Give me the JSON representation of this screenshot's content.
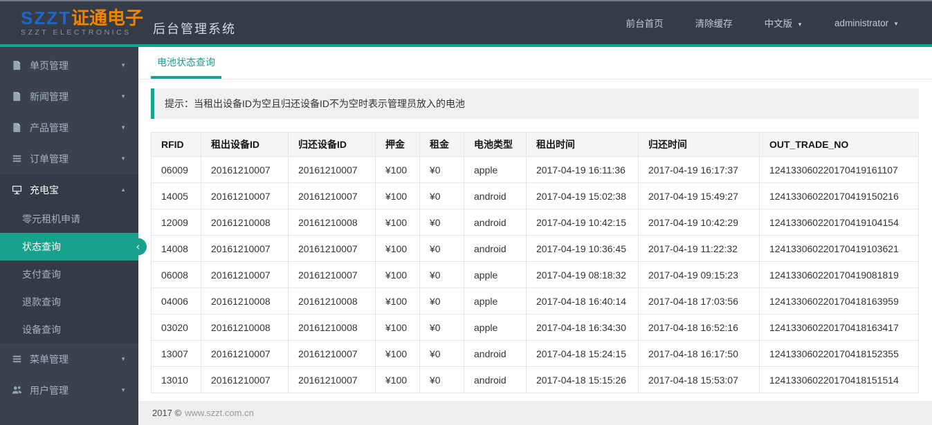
{
  "header": {
    "logo": {
      "brand": "SZZT",
      "brand_cn": "证通电子",
      "sub": "SZZT ELECTRONICS"
    },
    "app_title": "后台管理系统",
    "nav": [
      {
        "name": "home",
        "label": "前台首页",
        "caret": false
      },
      {
        "name": "clear-cache",
        "label": "清除缓存",
        "caret": false
      },
      {
        "name": "language",
        "label": "中文版",
        "caret": true
      },
      {
        "name": "user",
        "label": "administrator",
        "caret": true
      }
    ]
  },
  "sidebar": {
    "items": [
      {
        "name": "single-page",
        "label": "单页管理",
        "icon": "file-icon",
        "chevron": "down"
      },
      {
        "name": "news",
        "label": "新闻管理",
        "icon": "file-icon",
        "chevron": "down"
      },
      {
        "name": "product",
        "label": "产品管理",
        "icon": "file-icon",
        "chevron": "down"
      },
      {
        "name": "order",
        "label": "订单管理",
        "icon": "list-icon",
        "chevron": "down"
      },
      {
        "name": "powerbank",
        "label": "充电宝",
        "icon": "desktop-icon",
        "chevron": "up",
        "expanded": true,
        "children": [
          {
            "name": "zero-rent-apply",
            "label": "零元租机申请"
          },
          {
            "name": "status-query",
            "label": "状态查询",
            "active": true
          },
          {
            "name": "payment-query",
            "label": "支付查询"
          },
          {
            "name": "refund-query",
            "label": "退款查询"
          },
          {
            "name": "device-query",
            "label": "设备查询"
          }
        ]
      },
      {
        "name": "menu",
        "label": "菜单管理",
        "icon": "list-icon",
        "chevron": "down"
      },
      {
        "name": "user",
        "label": "用户管理",
        "icon": "users-icon",
        "chevron": "down"
      }
    ]
  },
  "main": {
    "tab": "电池状态查询",
    "tip": "提示：当租出设备ID为空且归还设备ID不为空时表示管理员放入的电池",
    "table": {
      "columns": [
        "RFID",
        "租出设备ID",
        "归还设备ID",
        "押金",
        "租金",
        "电池类型",
        "租出时间",
        "归还时间",
        "OUT_TRADE_NO"
      ],
      "rows": [
        [
          "06009",
          "20161210007",
          "20161210007",
          "¥100",
          "¥0",
          "apple",
          "2017-04-19 16:11:36",
          "2017-04-19 16:17:37",
          "124133060220170419161107"
        ],
        [
          "14005",
          "20161210007",
          "20161210007",
          "¥100",
          "¥0",
          "android",
          "2017-04-19 15:02:38",
          "2017-04-19 15:49:27",
          "124133060220170419150216"
        ],
        [
          "12009",
          "20161210008",
          "20161210008",
          "¥100",
          "¥0",
          "android",
          "2017-04-19 10:42:15",
          "2017-04-19 10:42:29",
          "124133060220170419104154"
        ],
        [
          "14008",
          "20161210007",
          "20161210007",
          "¥100",
          "¥0",
          "android",
          "2017-04-19 10:36:45",
          "2017-04-19 11:22:32",
          "124133060220170419103621"
        ],
        [
          "06008",
          "20161210007",
          "20161210007",
          "¥100",
          "¥0",
          "apple",
          "2017-04-19 08:18:32",
          "2017-04-19 09:15:23",
          "124133060220170419081819"
        ],
        [
          "04006",
          "20161210008",
          "20161210008",
          "¥100",
          "¥0",
          "apple",
          "2017-04-18 16:40:14",
          "2017-04-18 17:03:56",
          "124133060220170418163959"
        ],
        [
          "03020",
          "20161210008",
          "20161210008",
          "¥100",
          "¥0",
          "apple",
          "2017-04-18 16:34:30",
          "2017-04-18 16:52:16",
          "124133060220170418163417"
        ],
        [
          "13007",
          "20161210007",
          "20161210007",
          "¥100",
          "¥0",
          "android",
          "2017-04-18 15:24:15",
          "2017-04-18 16:17:50",
          "124133060220170418152355"
        ],
        [
          "13010",
          "20161210007",
          "20161210007",
          "¥100",
          "¥0",
          "android",
          "2017-04-18 15:15:26",
          "2017-04-18 15:53:07",
          "124133060220170418151514"
        ]
      ]
    }
  },
  "footer": {
    "year": "2017 ©",
    "domain": "www.szzt.com.cn"
  },
  "colors": {
    "accent": "#18a18c",
    "header_bg": "#353c47",
    "sidebar_bg": "#3a424e",
    "submenu_bg": "#333b46",
    "logo_blue": "#1e66c9",
    "logo_orange": "#f08300"
  }
}
